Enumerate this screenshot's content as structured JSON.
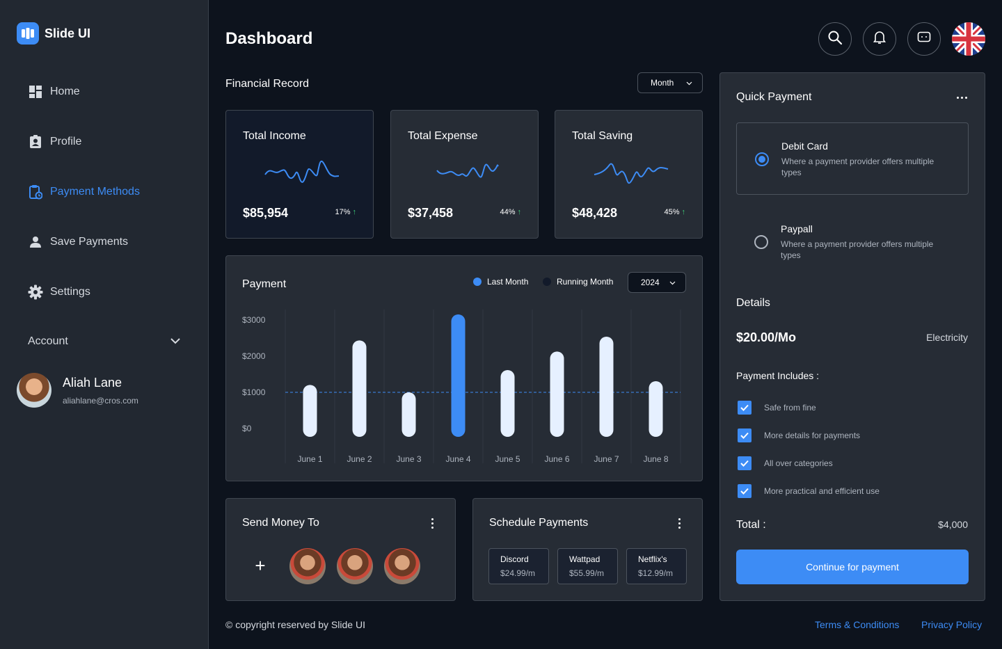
{
  "app": {
    "brand": "Slide UI"
  },
  "sidebar": {
    "items": [
      {
        "label": "Home",
        "icon": "dashboard-icon"
      },
      {
        "label": "Profile",
        "icon": "profile-icon"
      },
      {
        "label": "Payment Methods",
        "icon": "payment-icon",
        "active": true
      },
      {
        "label": "Save Payments",
        "icon": "user-icon"
      },
      {
        "label": "Settings",
        "icon": "gear-icon"
      }
    ],
    "account_label": "Account",
    "user": {
      "name": "Aliah Lane",
      "email": "aliahlane@cros.com"
    }
  },
  "header": {
    "title": "Dashboard"
  },
  "financial": {
    "title": "Financial Record",
    "filter": "Month",
    "cards": [
      {
        "label": "Total Income",
        "value": "$85,954",
        "pct": "17%"
      },
      {
        "label": "Total Expense",
        "value": "$37,458",
        "pct": "44%"
      },
      {
        "label": "Total Saving",
        "value": "$48,428",
        "pct": "45%"
      }
    ]
  },
  "payment": {
    "title": "Payment",
    "legend": [
      "Last Month",
      "Running Month"
    ],
    "year": "2024"
  },
  "chart_data": {
    "type": "bar",
    "categories": [
      "June 1",
      "June 2",
      "June 3",
      "June 4",
      "June 5",
      "June 6",
      "June 7",
      "June 8"
    ],
    "series": [
      {
        "values": [
          1400,
          2600,
          1200,
          3300,
          1800,
          2300,
          2700,
          1500
        ]
      }
    ],
    "highlight_index": 3,
    "yticks": [
      "$3000",
      "$2000",
      "$1000",
      "$0"
    ],
    "reference_line": 1000,
    "colors": {
      "bar": "#e6f0ff",
      "highlight": "#3d8cf5"
    }
  },
  "send_money": {
    "title": "Send Money To",
    "add": "+"
  },
  "schedule": {
    "title": "Schedule Payments",
    "items": [
      {
        "name": "Discord",
        "price": "$24.99/m"
      },
      {
        "name": "Wattpad",
        "price": "$55.99/m"
      },
      {
        "name": "Netflix's",
        "price": "$12.99/m"
      }
    ]
  },
  "quick_payment": {
    "title": "Quick Payment",
    "options": [
      {
        "title": "Debit Card",
        "desc": "Where a payment provider offers multiple types",
        "selected": true
      },
      {
        "title": "Paypall",
        "desc": "Where a payment provider offers multiple types",
        "selected": false
      }
    ],
    "details_title": "Details",
    "price": "$20.00/Mo",
    "category": "Electricity",
    "includes_title": "Payment Includes :",
    "includes": [
      "Safe from fine",
      "More details for payments",
      "All over categories",
      "More practical and efficient use"
    ],
    "total_label": "Total :",
    "total_value": "$4,000",
    "cta": "Continue for payment"
  },
  "footer": {
    "copyright": "© copyright reserved by Slide UI",
    "links": [
      "Terms & Conditions",
      "Privacy Policy"
    ]
  },
  "colors": {
    "accent": "#3d8cf5",
    "success": "#3fd07a",
    "panel": "#262c35",
    "background": "#0d131d"
  }
}
